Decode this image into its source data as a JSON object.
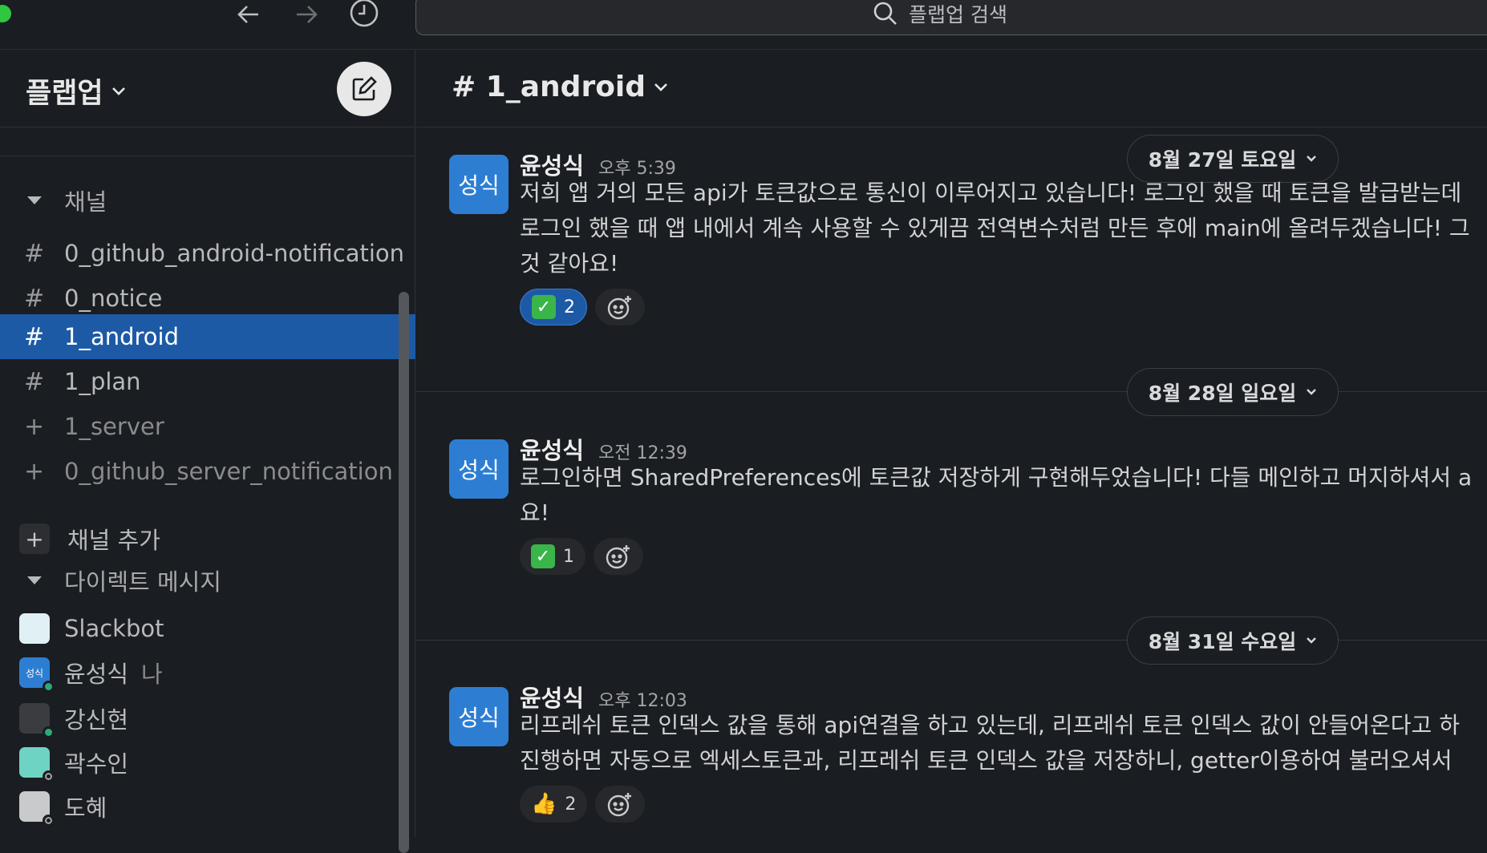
{
  "topbar": {
    "search_placeholder": "플랩업 검색"
  },
  "sidebar": {
    "workspace_name": "플랩업",
    "channels_section": "채널",
    "channels": [
      {
        "prefix": "#",
        "label": "0_github_android-notification",
        "state": "normal"
      },
      {
        "prefix": "#",
        "label": "0_notice",
        "state": "normal"
      },
      {
        "prefix": "#",
        "label": "1_android",
        "state": "active"
      },
      {
        "prefix": "#",
        "label": "1_plan",
        "state": "normal"
      },
      {
        "prefix": "+",
        "label": "1_server",
        "state": "muted"
      },
      {
        "prefix": "+",
        "label": "0_github_server_notification",
        "state": "muted"
      }
    ],
    "add_channel": "채널 추가",
    "add_channel_icon": "+",
    "dm_section": "다이렉트 메시지",
    "dms": [
      {
        "label": "Slackbot",
        "suffix": "",
        "avatar_color": "#e0f0f4",
        "presence": "none"
      },
      {
        "label": "윤성식",
        "suffix": "나",
        "avatar_text": "성식",
        "avatar_color": "#2d7ed3",
        "presence": "on"
      },
      {
        "label": "강신현",
        "suffix": "",
        "avatar_color": "#3a3c40",
        "presence": "on"
      },
      {
        "label": "곽수인",
        "suffix": "",
        "avatar_color": "#6fd3c3",
        "presence": "off"
      },
      {
        "label": "도혜",
        "suffix": "",
        "avatar_color": "#c9cacb",
        "presence": "off"
      }
    ]
  },
  "channel": {
    "title": "# 1_android"
  },
  "dates": [
    "8월 27일 토요일",
    "8월 28일 일요일",
    "8월 31일 수요일"
  ],
  "messages": [
    {
      "avatar": "성식",
      "author": "윤성식",
      "time": "오후 5:39",
      "lines": [
        "저희 앱 거의 모든 api가 토큰값으로 통신이 이루어지고 있습니다! 로그인 했을 때 토큰을 발급받는데",
        "로그인 했을 때 앱 내에서 계속 사용할 수 있게끔 전역변수처럼 만든 후에 main에 올려두겠습니다! 그",
        "것 같아요!"
      ],
      "reaction": {
        "emoji": "✓",
        "count": "2",
        "mine": true
      }
    },
    {
      "avatar": "성식",
      "author": "윤성식",
      "time": "오전 12:39",
      "lines": [
        "로그인하면 SharedPreferences에 토큰값 저장하게 구현해두었습니다! 다들 메인하고 머지하셔서 a",
        "요!"
      ],
      "reaction": {
        "emoji": "✓",
        "count": "1",
        "mine": false
      }
    },
    {
      "avatar": "성식",
      "author": "윤성식",
      "time": "오후 12:03",
      "lines": [
        "리프레쉬 토큰 인덱스 값을 통해 api연결을 하고 있는데, 리프레쉬 토큰 인덱스 값이 안들어온다고 하",
        "진행하면 자동으로 엑세스토큰과, 리프레쉬 토큰 인덱스 값을 저장하니, getter이용하여 불러오셔서"
      ],
      "reaction": {
        "emoji": "👍",
        "count": "2",
        "mine": false
      }
    }
  ]
}
